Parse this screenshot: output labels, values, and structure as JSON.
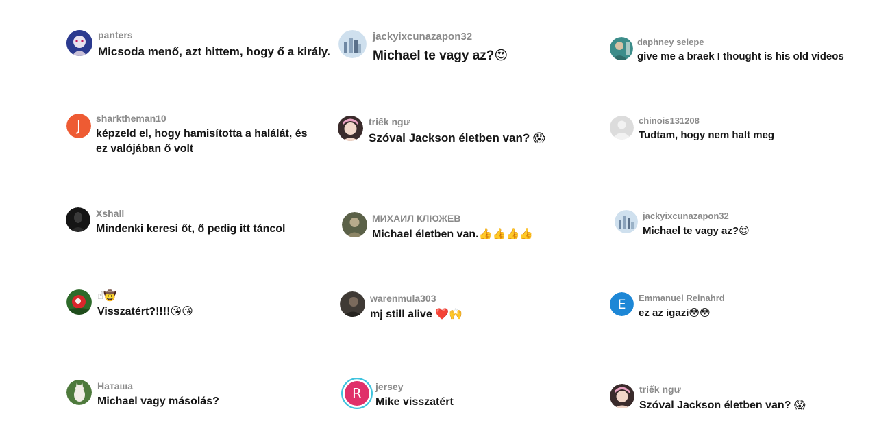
{
  "comments": [
    {
      "username": "panters",
      "text": "Micsoda menő, azt hittem, hogy ő a király.",
      "avatar_icon": "anime-avatar-icon"
    },
    {
      "username": "jackyixcunazapon32",
      "text": "Michael te vagy az?",
      "emoji": "😍",
      "avatar_icon": "city-avatar-icon"
    },
    {
      "username": "daphney selepe",
      "text": "give me a braek I thought is his old videos",
      "avatar_icon": "photo-avatar-icon"
    },
    {
      "username": "sharktheman10",
      "text": "képzeld el, hogy hamisította a halálát, és ez valójában ő volt",
      "avatar_letter": "J",
      "avatar_color": "#ee5b33"
    },
    {
      "username": "triếk ngư",
      "text": "Szóval Jackson életben van?",
      "emoji": "😱",
      "avatar_icon": "girl-avatar-icon"
    },
    {
      "username": "chinois131208",
      "text": "Tudtam, hogy nem halt meg",
      "avatar_icon": "default-user-icon"
    },
    {
      "username": "Xshall",
      "text": "Mindenki keresi őt, ő pedig itt táncol",
      "avatar_icon": "dark-avatar-icon"
    },
    {
      "username": "МИХАИЛ КЛЮЖЕВ",
      "text": "Michael életben van.",
      "emoji": "👍👍👍👍",
      "avatar_icon": "portrait-avatar-icon"
    },
    {
      "username": "jackyixcunazapon32",
      "text": "Michael te vagy az?",
      "emoji": "😍",
      "avatar_icon": "city-avatar-icon"
    },
    {
      "username": "☝🤠",
      "text": "Visszatért?!!!!",
      "emoji": "😘😘",
      "avatar_icon": "flower-avatar-icon"
    },
    {
      "username": "warenmula303",
      "text": "mj still alive",
      "emoji": "❤️🙌",
      "avatar_icon": "photo-avatar-icon"
    },
    {
      "username": "Emmanuel Reinahrd",
      "text": "ez az igazi",
      "emoji": "😳😳",
      "avatar_letter": "E",
      "avatar_color": "#1d87d6"
    },
    {
      "username": "Наташа",
      "text": "Michael vagy másolás?",
      "avatar_icon": "cat-avatar-icon"
    },
    {
      "username": "jersey",
      "text": "Mike visszatért",
      "avatar_letter": "R",
      "avatar_color": "#e0306a",
      "avatar_ring": "#3fc3de"
    },
    {
      "username": "triếk ngư",
      "text": "Szóval Jackson életben van?",
      "emoji": "😱",
      "avatar_icon": "girl-avatar-icon"
    }
  ]
}
